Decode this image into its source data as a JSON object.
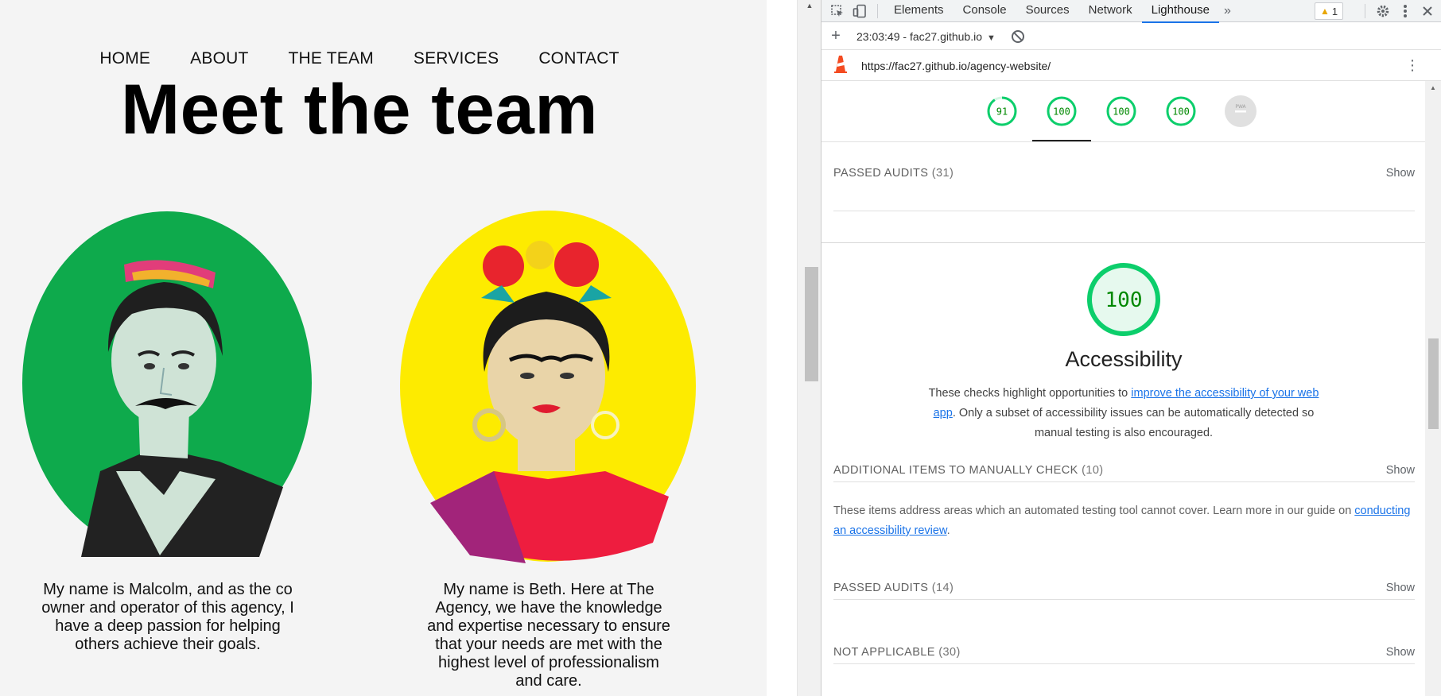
{
  "site": {
    "nav": [
      "HOME",
      "ABOUT",
      "THE TEAM",
      "SERVICES",
      "CONTACT"
    ],
    "title": "Meet the team",
    "members": [
      {
        "bio": "My name is Malcolm, and as the co owner and operator of this agency, I have a deep passion for helping others achieve their goals.",
        "bg_color": "#0eaa4c"
      },
      {
        "bio": "My name is Beth. Here at The Agency, we have the knowledge and expertise necessary to ensure that your needs are met with the highest level of professionalism and care.",
        "bg_color": "#fdeb00"
      }
    ]
  },
  "devtools": {
    "tabs": [
      "Elements",
      "Console",
      "Sources",
      "Network",
      "Lighthouse"
    ],
    "active_tab": "Lighthouse",
    "more_tabs_icon": "chevron-double-right-icon",
    "warnings_count": "1",
    "toolbar": {
      "report_label": "23:03:49 - fac27.github.io"
    },
    "url": "https://fac27.github.io/agency-website/",
    "gauges": [
      {
        "score": "91",
        "color": "#0cce6b"
      },
      {
        "score": "100",
        "color": "#0cce6b"
      },
      {
        "score": "100",
        "color": "#0cce6b"
      },
      {
        "score": "100",
        "color": "#0cce6b"
      },
      {
        "score": "PWA",
        "color": "#b0b0b0"
      }
    ],
    "passed_audits_top": {
      "label": "PASSED AUDITS",
      "count": "(31)",
      "action": "Show"
    },
    "category": {
      "score": "100",
      "title": "Accessibility",
      "desc_pre": "These checks highlight opportunities to ",
      "desc_link": "improve the accessibility of your web app",
      "desc_post": ". Only a subset of accessibility issues can be automatically detected so manual testing is also encouraged."
    },
    "groups": [
      {
        "label": "ADDITIONAL ITEMS TO MANUALLY CHECK",
        "count": "(10)",
        "action": "Show"
      },
      {
        "label": "PASSED AUDITS",
        "count": "(14)",
        "action": "Show"
      },
      {
        "label": "NOT APPLICABLE",
        "count": "(30)",
        "action": "Show"
      }
    ],
    "manual_desc_pre": "These items address areas which an automated testing tool cannot cover. Learn more in our guide on ",
    "manual_desc_link": "conducting an accessibility review",
    "manual_desc_post": "."
  },
  "colors": {
    "pass_green": "#0cce6b",
    "pass_text": "#008800",
    "link_blue": "#1a73e8",
    "lighthouse_orange": "#f44b21"
  }
}
